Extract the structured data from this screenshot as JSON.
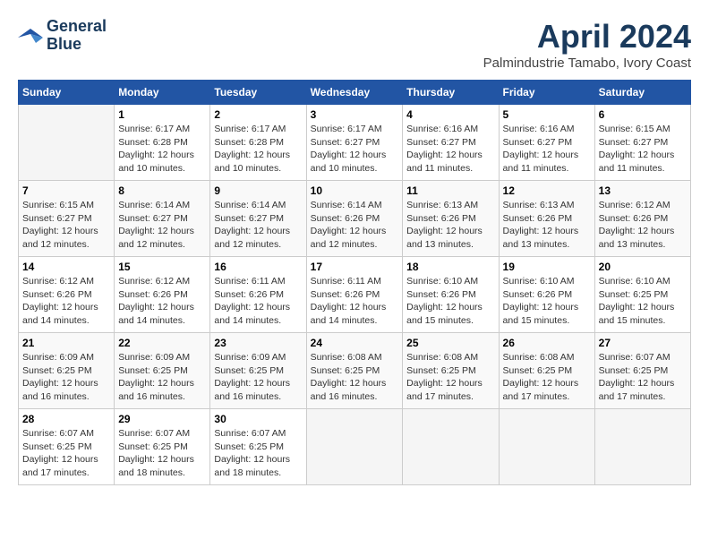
{
  "logo": {
    "line1": "General",
    "line2": "Blue"
  },
  "title": {
    "month_year": "April 2024",
    "location": "Palmindustrie Tamabo, Ivory Coast"
  },
  "weekdays": [
    "Sunday",
    "Monday",
    "Tuesday",
    "Wednesday",
    "Thursday",
    "Friday",
    "Saturday"
  ],
  "weeks": [
    [
      {
        "day": "",
        "info": ""
      },
      {
        "day": "1",
        "info": "Sunrise: 6:17 AM\nSunset: 6:28 PM\nDaylight: 12 hours\nand 10 minutes."
      },
      {
        "day": "2",
        "info": "Sunrise: 6:17 AM\nSunset: 6:28 PM\nDaylight: 12 hours\nand 10 minutes."
      },
      {
        "day": "3",
        "info": "Sunrise: 6:17 AM\nSunset: 6:27 PM\nDaylight: 12 hours\nand 10 minutes."
      },
      {
        "day": "4",
        "info": "Sunrise: 6:16 AM\nSunset: 6:27 PM\nDaylight: 12 hours\nand 11 minutes."
      },
      {
        "day": "5",
        "info": "Sunrise: 6:16 AM\nSunset: 6:27 PM\nDaylight: 12 hours\nand 11 minutes."
      },
      {
        "day": "6",
        "info": "Sunrise: 6:15 AM\nSunset: 6:27 PM\nDaylight: 12 hours\nand 11 minutes."
      }
    ],
    [
      {
        "day": "7",
        "info": "Sunrise: 6:15 AM\nSunset: 6:27 PM\nDaylight: 12 hours\nand 12 minutes."
      },
      {
        "day": "8",
        "info": "Sunrise: 6:14 AM\nSunset: 6:27 PM\nDaylight: 12 hours\nand 12 minutes."
      },
      {
        "day": "9",
        "info": "Sunrise: 6:14 AM\nSunset: 6:27 PM\nDaylight: 12 hours\nand 12 minutes."
      },
      {
        "day": "10",
        "info": "Sunrise: 6:14 AM\nSunset: 6:26 PM\nDaylight: 12 hours\nand 12 minutes."
      },
      {
        "day": "11",
        "info": "Sunrise: 6:13 AM\nSunset: 6:26 PM\nDaylight: 12 hours\nand 13 minutes."
      },
      {
        "day": "12",
        "info": "Sunrise: 6:13 AM\nSunset: 6:26 PM\nDaylight: 12 hours\nand 13 minutes."
      },
      {
        "day": "13",
        "info": "Sunrise: 6:12 AM\nSunset: 6:26 PM\nDaylight: 12 hours\nand 13 minutes."
      }
    ],
    [
      {
        "day": "14",
        "info": "Sunrise: 6:12 AM\nSunset: 6:26 PM\nDaylight: 12 hours\nand 14 minutes."
      },
      {
        "day": "15",
        "info": "Sunrise: 6:12 AM\nSunset: 6:26 PM\nDaylight: 12 hours\nand 14 minutes."
      },
      {
        "day": "16",
        "info": "Sunrise: 6:11 AM\nSunset: 6:26 PM\nDaylight: 12 hours\nand 14 minutes."
      },
      {
        "day": "17",
        "info": "Sunrise: 6:11 AM\nSunset: 6:26 PM\nDaylight: 12 hours\nand 14 minutes."
      },
      {
        "day": "18",
        "info": "Sunrise: 6:10 AM\nSunset: 6:26 PM\nDaylight: 12 hours\nand 15 minutes."
      },
      {
        "day": "19",
        "info": "Sunrise: 6:10 AM\nSunset: 6:26 PM\nDaylight: 12 hours\nand 15 minutes."
      },
      {
        "day": "20",
        "info": "Sunrise: 6:10 AM\nSunset: 6:25 PM\nDaylight: 12 hours\nand 15 minutes."
      }
    ],
    [
      {
        "day": "21",
        "info": "Sunrise: 6:09 AM\nSunset: 6:25 PM\nDaylight: 12 hours\nand 16 minutes."
      },
      {
        "day": "22",
        "info": "Sunrise: 6:09 AM\nSunset: 6:25 PM\nDaylight: 12 hours\nand 16 minutes."
      },
      {
        "day": "23",
        "info": "Sunrise: 6:09 AM\nSunset: 6:25 PM\nDaylight: 12 hours\nand 16 minutes."
      },
      {
        "day": "24",
        "info": "Sunrise: 6:08 AM\nSunset: 6:25 PM\nDaylight: 12 hours\nand 16 minutes."
      },
      {
        "day": "25",
        "info": "Sunrise: 6:08 AM\nSunset: 6:25 PM\nDaylight: 12 hours\nand 17 minutes."
      },
      {
        "day": "26",
        "info": "Sunrise: 6:08 AM\nSunset: 6:25 PM\nDaylight: 12 hours\nand 17 minutes."
      },
      {
        "day": "27",
        "info": "Sunrise: 6:07 AM\nSunset: 6:25 PM\nDaylight: 12 hours\nand 17 minutes."
      }
    ],
    [
      {
        "day": "28",
        "info": "Sunrise: 6:07 AM\nSunset: 6:25 PM\nDaylight: 12 hours\nand 17 minutes."
      },
      {
        "day": "29",
        "info": "Sunrise: 6:07 AM\nSunset: 6:25 PM\nDaylight: 12 hours\nand 18 minutes."
      },
      {
        "day": "30",
        "info": "Sunrise: 6:07 AM\nSunset: 6:25 PM\nDaylight: 12 hours\nand 18 minutes."
      },
      {
        "day": "",
        "info": ""
      },
      {
        "day": "",
        "info": ""
      },
      {
        "day": "",
        "info": ""
      },
      {
        "day": "",
        "info": ""
      }
    ]
  ]
}
